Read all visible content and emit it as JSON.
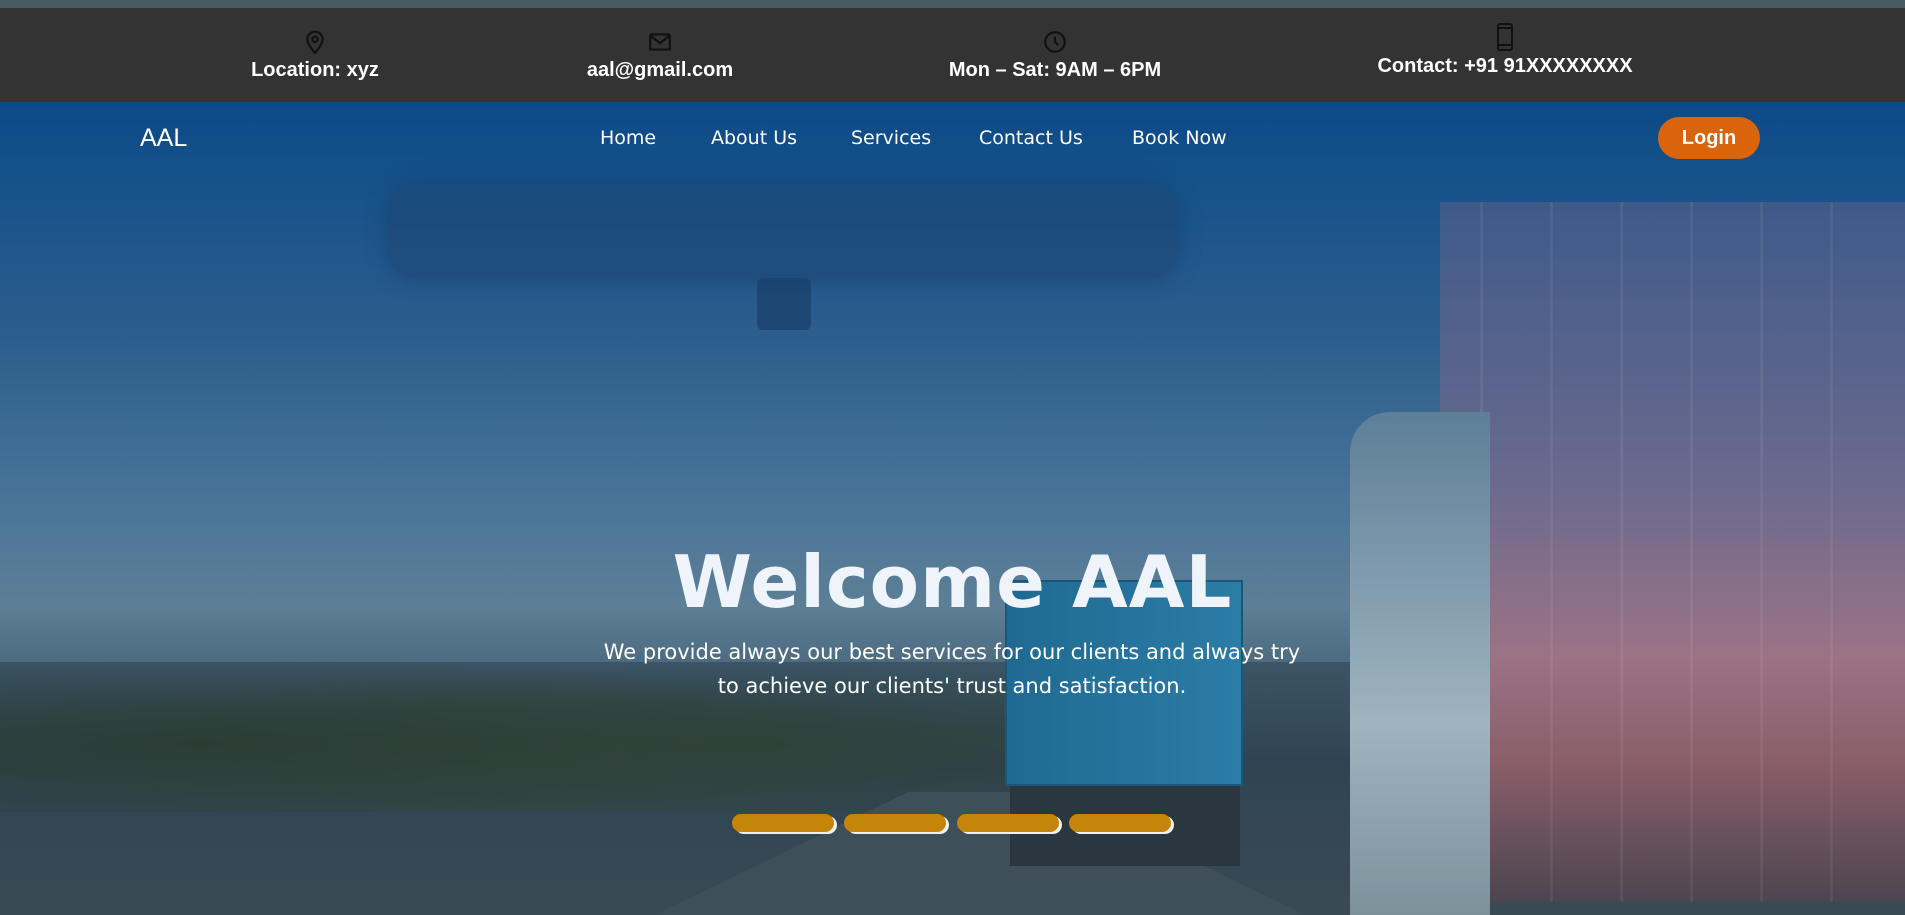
{
  "infobar": {
    "items": [
      {
        "icon": "location-pin-icon",
        "text": "Location: xyz"
      },
      {
        "icon": "mail-icon",
        "text": "aal@gmail.com"
      },
      {
        "icon": "clock-icon",
        "text": "Mon – Sat: 9AM – 6PM"
      },
      {
        "icon": "phone-icon",
        "text": "Contact: +91 91XXXXXXXX"
      }
    ]
  },
  "navbar": {
    "brand": "AAL",
    "links": [
      "Home",
      "About Us",
      "Services",
      "Contact Us",
      "Book Now"
    ],
    "login_label": "Login"
  },
  "hero": {
    "title": "Welcome AAL",
    "subtitle": "We provide always our best services for our clients and always try to achieve our clients' trust and satisfaction.",
    "slide_count": 4
  },
  "colors": {
    "infobar_bg": "#333333",
    "navbar_bg": "#0e4a86",
    "login_button": "#d9640c",
    "carousel_indicator": "#c5840a"
  }
}
